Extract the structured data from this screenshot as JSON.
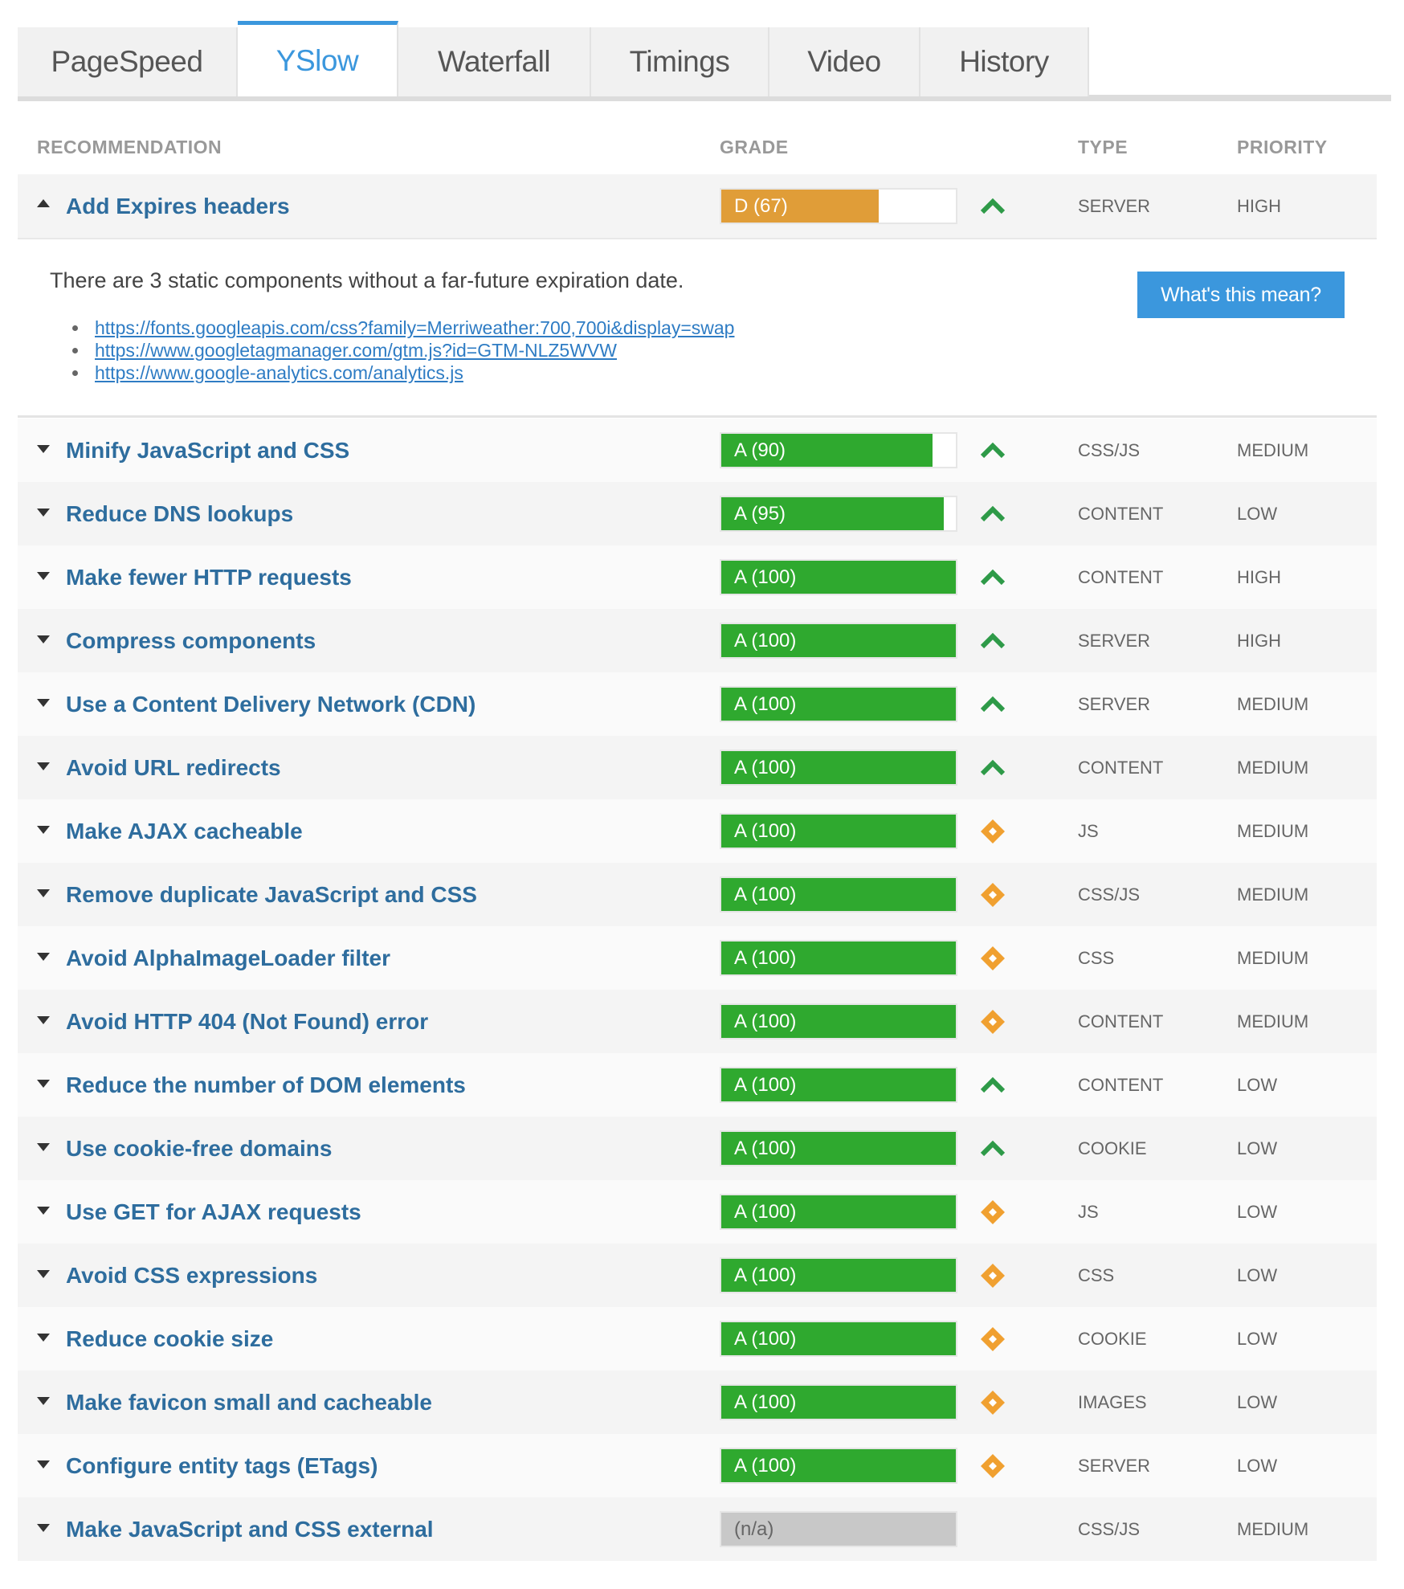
{
  "tabs": [
    {
      "label": "PageSpeed",
      "active": false
    },
    {
      "label": "YSlow",
      "active": true
    },
    {
      "label": "Waterfall",
      "active": false
    },
    {
      "label": "Timings",
      "active": false
    },
    {
      "label": "Video",
      "active": false
    },
    {
      "label": "History",
      "active": false
    }
  ],
  "columns": {
    "recommendation": "RECOMMENDATION",
    "grade": "GRADE",
    "type": "TYPE",
    "priority": "PRIORITY"
  },
  "colors": {
    "grade_a": "#2fa92f",
    "grade_d": "#e09d38",
    "grade_na": "#c8c8c8",
    "trend_up": "#2e9a48",
    "trend_neutral": "#f0a030",
    "link": "#2e6d9e",
    "accent": "#3b97dd"
  },
  "expanded": {
    "description": "There are 3 static components without a far-future expiration date.",
    "button_label": "What's this mean?",
    "links": [
      "https://fonts.googleapis.com/css?family=Merriweather:700,700i&display=swap",
      "https://www.googletagmanager.com/gtm.js?id=GTM-NLZ5WVW",
      "https://www.google-analytics.com/analytics.js"
    ]
  },
  "recommendations": [
    {
      "name": "Add Expires headers",
      "grade": "D (67)",
      "score": 67,
      "letter": "D",
      "trend": "up-icon",
      "type": "SERVER",
      "priority": "HIGH",
      "expanded": true
    },
    {
      "name": "Minify JavaScript and CSS",
      "grade": "A (90)",
      "score": 90,
      "letter": "A",
      "trend": "up-icon",
      "type": "CSS/JS",
      "priority": "MEDIUM"
    },
    {
      "name": "Reduce DNS lookups",
      "grade": "A (95)",
      "score": 95,
      "letter": "A",
      "trend": "up-icon",
      "type": "CONTENT",
      "priority": "LOW"
    },
    {
      "name": "Make fewer HTTP requests",
      "grade": "A (100)",
      "score": 100,
      "letter": "A",
      "trend": "up-icon",
      "type": "CONTENT",
      "priority": "HIGH"
    },
    {
      "name": "Compress components",
      "grade": "A (100)",
      "score": 100,
      "letter": "A",
      "trend": "up-icon",
      "type": "SERVER",
      "priority": "HIGH"
    },
    {
      "name": "Use a Content Delivery Network (CDN)",
      "grade": "A (100)",
      "score": 100,
      "letter": "A",
      "trend": "up-icon",
      "type": "SERVER",
      "priority": "MEDIUM"
    },
    {
      "name": "Avoid URL redirects",
      "grade": "A (100)",
      "score": 100,
      "letter": "A",
      "trend": "up-icon",
      "type": "CONTENT",
      "priority": "MEDIUM"
    },
    {
      "name": "Make AJAX cacheable",
      "grade": "A (100)",
      "score": 100,
      "letter": "A",
      "trend": "neutral-icon",
      "type": "JS",
      "priority": "MEDIUM"
    },
    {
      "name": "Remove duplicate JavaScript and CSS",
      "grade": "A (100)",
      "score": 100,
      "letter": "A",
      "trend": "neutral-icon",
      "type": "CSS/JS",
      "priority": "MEDIUM"
    },
    {
      "name": "Avoid AlphaImageLoader filter",
      "grade": "A (100)",
      "score": 100,
      "letter": "A",
      "trend": "neutral-icon",
      "type": "CSS",
      "priority": "MEDIUM"
    },
    {
      "name": "Avoid HTTP 404 (Not Found) error",
      "grade": "A (100)",
      "score": 100,
      "letter": "A",
      "trend": "neutral-icon",
      "type": "CONTENT",
      "priority": "MEDIUM"
    },
    {
      "name": "Reduce the number of DOM elements",
      "grade": "A (100)",
      "score": 100,
      "letter": "A",
      "trend": "up-icon",
      "type": "CONTENT",
      "priority": "LOW"
    },
    {
      "name": "Use cookie-free domains",
      "grade": "A (100)",
      "score": 100,
      "letter": "A",
      "trend": "up-icon",
      "type": "COOKIE",
      "priority": "LOW"
    },
    {
      "name": "Use GET for AJAX requests",
      "grade": "A (100)",
      "score": 100,
      "letter": "A",
      "trend": "neutral-icon",
      "type": "JS",
      "priority": "LOW"
    },
    {
      "name": "Avoid CSS expressions",
      "grade": "A (100)",
      "score": 100,
      "letter": "A",
      "trend": "neutral-icon",
      "type": "CSS",
      "priority": "LOW"
    },
    {
      "name": "Reduce cookie size",
      "grade": "A (100)",
      "score": 100,
      "letter": "A",
      "trend": "neutral-icon",
      "type": "COOKIE",
      "priority": "LOW"
    },
    {
      "name": "Make favicon small and cacheable",
      "grade": "A (100)",
      "score": 100,
      "letter": "A",
      "trend": "neutral-icon",
      "type": "IMAGES",
      "priority": "LOW"
    },
    {
      "name": "Configure entity tags (ETags)",
      "grade": "A (100)",
      "score": 100,
      "letter": "A",
      "trend": "neutral-icon",
      "type": "SERVER",
      "priority": "LOW"
    },
    {
      "name": "Make JavaScript and CSS external",
      "grade": "(n/a)",
      "score": null,
      "letter": "n/a",
      "trend": "",
      "type": "CSS/JS",
      "priority": "MEDIUM"
    }
  ]
}
